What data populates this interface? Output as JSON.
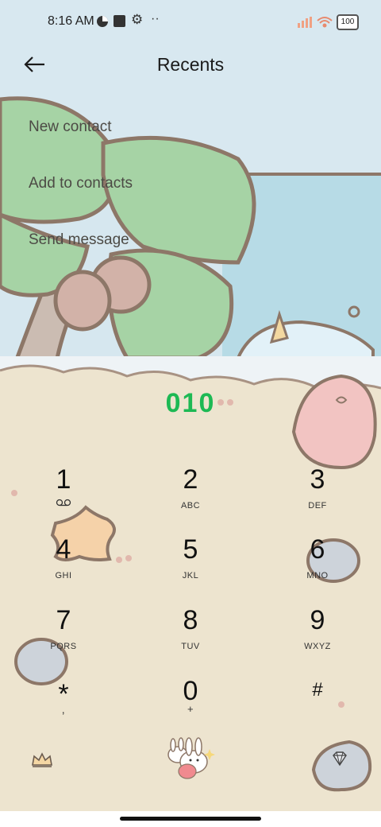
{
  "status_bar": {
    "time": "8:16 AM",
    "battery": "100",
    "icons": [
      "vpn-icon",
      "square-notification-icon",
      "gear-icon",
      "more-dots-icon",
      "signal-icon",
      "wifi-icon",
      "battery-icon"
    ]
  },
  "header": {
    "title": "Recents",
    "back_icon": "arrow-left-icon"
  },
  "actions": [
    {
      "label": "New contact"
    },
    {
      "label": "Add to contacts"
    },
    {
      "label": "Send message"
    }
  ],
  "dialer": {
    "number": "010",
    "number_color": "#1db954"
  },
  "keypad": [
    {
      "digit": "1",
      "letters": ""
    },
    {
      "digit": "2",
      "letters": "ABC"
    },
    {
      "digit": "3",
      "letters": "DEF"
    },
    {
      "digit": "4",
      "letters": "GHI"
    },
    {
      "digit": "5",
      "letters": "JKL"
    },
    {
      "digit": "6",
      "letters": "MNO"
    },
    {
      "digit": "7",
      "letters": "PQRS"
    },
    {
      "digit": "8",
      "letters": "TUV"
    },
    {
      "digit": "9",
      "letters": "WXYZ"
    },
    {
      "digit": "*",
      "letters": ","
    },
    {
      "digit": "0",
      "letters": "+"
    },
    {
      "digit": "#",
      "letters": ""
    }
  ],
  "bottom_bar": {
    "left_icon": "crown-icon",
    "center_icon": "bunny-call-icon",
    "right_icon": "diamond-icon"
  }
}
